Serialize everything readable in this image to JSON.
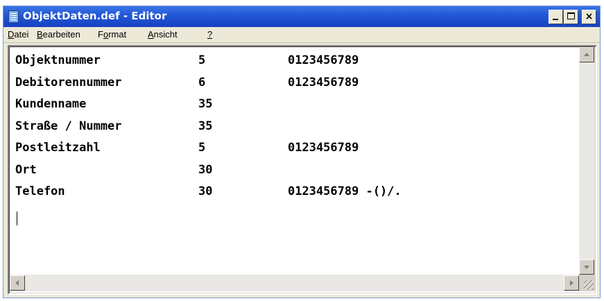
{
  "window": {
    "title": "ObjektDaten.def - Editor",
    "icon": "notepad-icon",
    "controls": {
      "minimize": "minimize-icon",
      "maximize": "maximize-icon",
      "close": "close-icon",
      "close_glyph": "×"
    }
  },
  "menu": {
    "items": [
      {
        "mnemonic": "D",
        "rest": "atei"
      },
      {
        "mnemonic": "B",
        "rest": "earbeiten"
      },
      {
        "pre": "F",
        "mnemonic": "o",
        "rest": "rmat"
      },
      {
        "mnemonic": "A",
        "rest": "nsicht"
      },
      {
        "mnemonic": "?",
        "rest": ""
      }
    ]
  },
  "editor": {
    "lines": [
      {
        "field": "Objektnummer",
        "length": "5",
        "allowed": "0123456789"
      },
      {
        "field": "Debitorennummer",
        "length": "6",
        "allowed": "0123456789"
      },
      {
        "field": "Kundenname",
        "length": "35",
        "allowed": ""
      },
      {
        "field": "Straße / Nummer",
        "length": "35",
        "allowed": ""
      },
      {
        "field": "Postleitzahl",
        "length": "5",
        "allowed": "0123456789"
      },
      {
        "field": "Ort",
        "length": "30",
        "allowed": ""
      },
      {
        "field": "Telefon",
        "length": "30",
        "allowed": "0123456789 -()/."
      }
    ]
  },
  "colors": {
    "titlebar": "#2458d6",
    "window_bg": "#ece9d8",
    "text": "#000000"
  }
}
